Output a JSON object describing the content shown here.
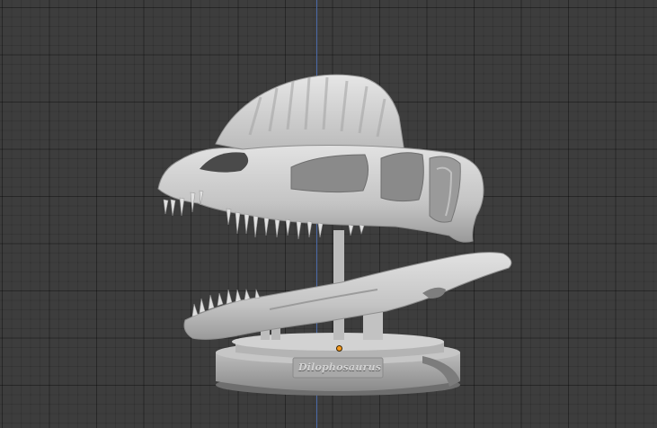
{
  "viewport": {
    "background_color": "#3d3d3d",
    "grid_color": "#2f2f2f",
    "z_axis_color": "#4b6aa8",
    "origin_color": "#f59a20"
  },
  "model": {
    "material_color": "#c8c8c8",
    "plaque_text": "Dilophosaurus"
  }
}
